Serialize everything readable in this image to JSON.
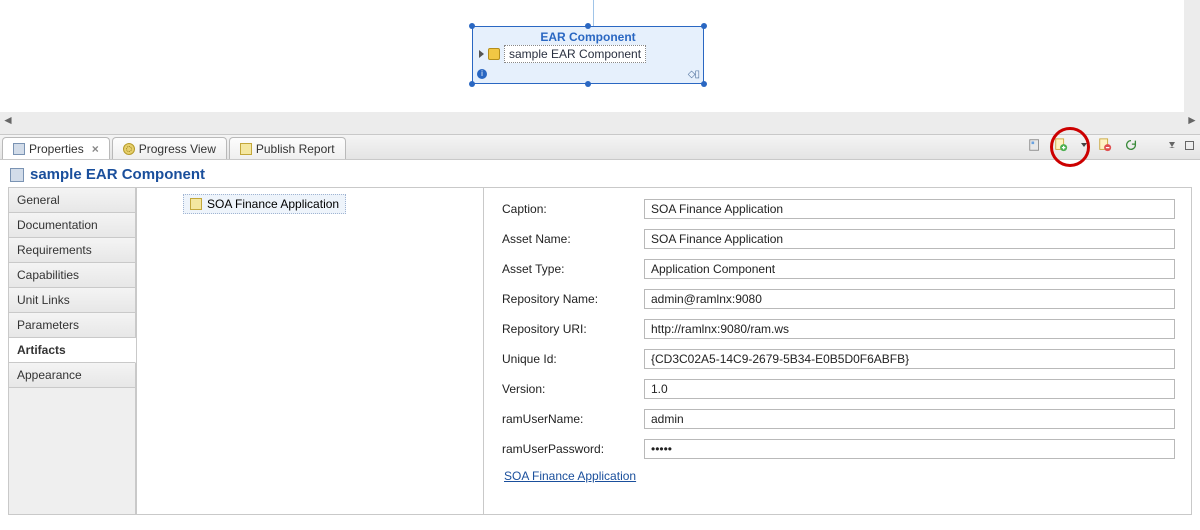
{
  "diagram": {
    "header": "EAR Component",
    "name": "sample EAR Component"
  },
  "tabs": {
    "properties": "Properties",
    "progress": "Progress View",
    "publish": "Publish Report"
  },
  "propertiesTitle": "sample EAR Component",
  "sideTabs": [
    "General",
    "Documentation",
    "Requirements",
    "Capabilities",
    "Unit Links",
    "Parameters",
    "Artifacts",
    "Appearance"
  ],
  "sideSelectedIndex": 6,
  "treeItem": "SOA Finance Application",
  "form": {
    "rows": [
      {
        "label": "Caption:",
        "value": "SOA Finance Application"
      },
      {
        "label": "Asset Name:",
        "value": "SOA Finance Application"
      },
      {
        "label": "Asset Type:",
        "value": "Application Component"
      },
      {
        "label": "Repository Name:",
        "value": "admin@ramlnx:9080"
      },
      {
        "label": "Repository URI:",
        "value": "http://ramlnx:9080/ram.ws"
      },
      {
        "label": "Unique Id:",
        "value": "{CD3C02A5-14C9-2679-5B34-E0B5D0F6ABFB}"
      },
      {
        "label": "Version:",
        "value": "1.0"
      },
      {
        "label": "ramUserName:",
        "value": "admin"
      },
      {
        "label": "ramUserPassword:",
        "value": "•••••"
      }
    ],
    "link": "SOA Finance Application"
  }
}
